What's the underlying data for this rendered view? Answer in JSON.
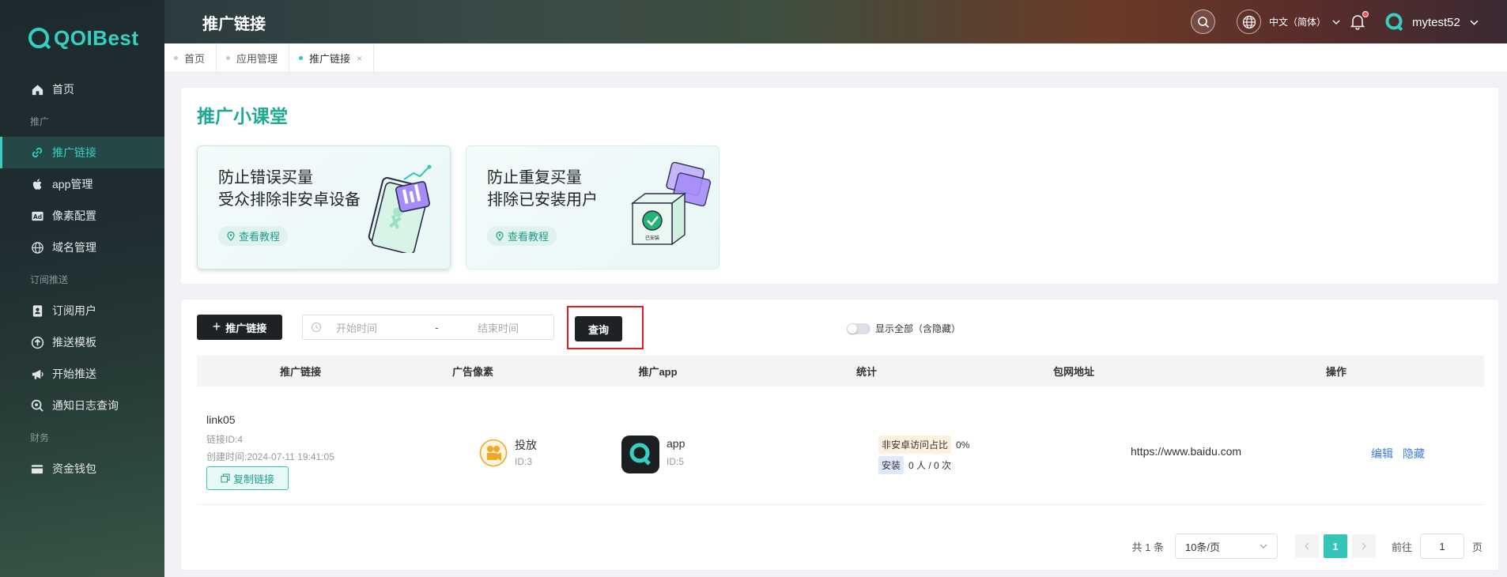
{
  "brand": {
    "name": "QOIBest",
    "accent": "#35d0c2"
  },
  "sidebar": {
    "items": [
      {
        "type": "item",
        "label": "首页",
        "icon": "home-icon"
      },
      {
        "type": "group",
        "label": "推广"
      },
      {
        "type": "item",
        "label": "推广链接",
        "icon": "link-icon",
        "active": true
      },
      {
        "type": "item",
        "label": "app管理",
        "icon": "apple-icon"
      },
      {
        "type": "item",
        "label": "像素配置",
        "icon": "ad-icon"
      },
      {
        "type": "item",
        "label": "域名管理",
        "icon": "globe-icon"
      },
      {
        "type": "group",
        "label": "订阅推送"
      },
      {
        "type": "item",
        "label": "订阅用户",
        "icon": "contact-icon"
      },
      {
        "type": "item",
        "label": "推送模板",
        "icon": "upload-icon"
      },
      {
        "type": "item",
        "label": "开始推送",
        "icon": "megaphone-icon"
      },
      {
        "type": "item",
        "label": "通知日志查询",
        "icon": "search-log-icon"
      },
      {
        "type": "group",
        "label": "财务"
      },
      {
        "type": "item",
        "label": "资金钱包",
        "icon": "wallet-icon"
      }
    ]
  },
  "header": {
    "title": "推广链接",
    "language": "中文（简体）",
    "username": "mytest52"
  },
  "tabs": [
    {
      "label": "首页",
      "active": false,
      "closable": false
    },
    {
      "label": "应用管理",
      "active": false,
      "closable": false
    },
    {
      "label": "推广链接",
      "active": true,
      "closable": true,
      "close": "×"
    }
  ],
  "lessons": {
    "title": "推广小课堂",
    "cards": [
      {
        "line1": "防止错误买量",
        "line2": "受众排除非安卓设备",
        "button": "查看教程"
      },
      {
        "line1": "防止重复买量",
        "line2": "排除已安装用户",
        "button": "查看教程",
        "art_label": "已安装"
      }
    ]
  },
  "toolbar": {
    "add_label": "推广链接",
    "start_placeholder": "开始时间",
    "separator": "-",
    "end_placeholder": "结束时间",
    "query_label": "查询",
    "toggle_label": "显示全部（含隐藏）"
  },
  "table": {
    "headers": [
      "推广链接",
      "广告像素",
      "推广app",
      "统计",
      "包网地址",
      "操作"
    ],
    "rows": [
      {
        "link_name": "link05",
        "link_id": "链接ID:4",
        "created": "创建时间:2024-07-11 19:41:05",
        "copy_label": "复制链接",
        "pixel_name": "投放",
        "pixel_id": "ID:3",
        "app_name": "app",
        "app_id": "ID:5",
        "stat_tag1": "非安卓访问占比",
        "stat_val1": "0%",
        "stat_tag2": "安装",
        "stat_val2": "0 人 / 0 次",
        "pkg_url": "https://www.baidu.com",
        "op_edit": "编辑",
        "op_hide": "隐藏"
      }
    ]
  },
  "pagination": {
    "total": "共 1 条",
    "page_size": "10条/页",
    "current": "1",
    "goto_label": "前往",
    "goto_value": "1",
    "page_unit": "页"
  }
}
